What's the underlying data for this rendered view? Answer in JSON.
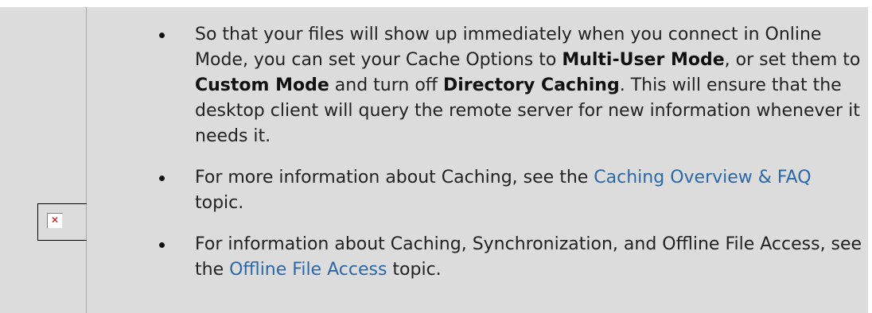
{
  "bullets": [
    {
      "t1": "So that your files will show up immediately when you connect in Online Mode, you can set your Cache Options to ",
      "b1": "Multi-User Mode",
      "t2": ", or set them to ",
      "b2": "Custom Mode",
      "t3": " and turn off ",
      "b3": "Directory Caching",
      "t4": ". This will ensure that the desktop client will query the remote server for new information whenever it needs it."
    },
    {
      "t1": "For more information about Caching, see the ",
      "link": "Caching Overview & FAQ",
      "t2": " topic."
    },
    {
      "t1": "For information about Caching, Synchronization, and Offline File Access, see the ",
      "link": "Offline File Access",
      "t2": " topic."
    }
  ],
  "colors": {
    "panel_bg": "#dcdcdc",
    "link": "#2a68a8",
    "broken_image_x": "#d40000"
  },
  "icons": {
    "broken_image": "broken-image-icon"
  }
}
